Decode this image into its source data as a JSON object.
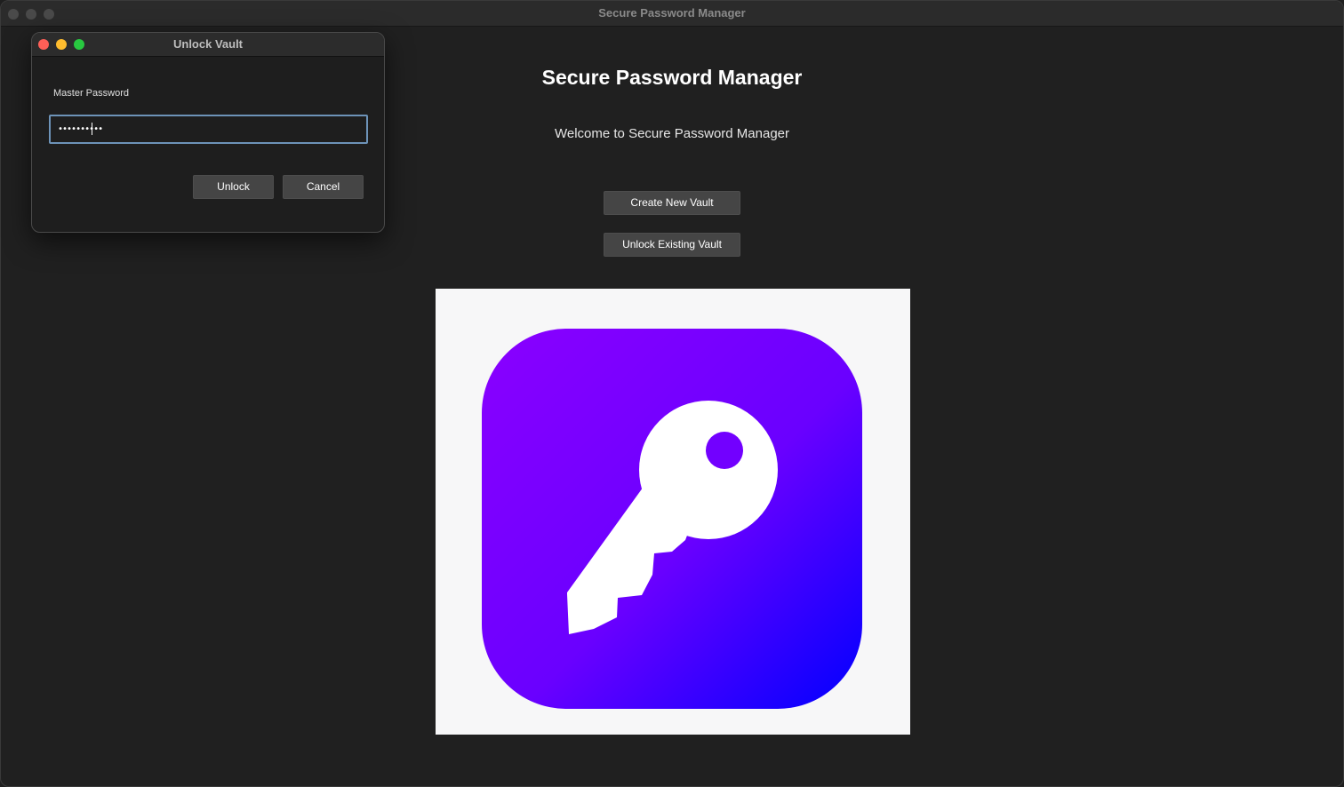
{
  "window": {
    "title": "Secure Password Manager"
  },
  "main": {
    "heading": "Secure Password Manager",
    "welcome": "Welcome to Secure Password Manager",
    "create_button": "Create New Vault",
    "unlock_button": "Unlock Existing Vault",
    "logo_icon": "key-icon",
    "logo_gradient": [
      "#8a00ff",
      "#6a00ff",
      "#0000ff"
    ]
  },
  "dialog": {
    "title": "Unlock Vault",
    "field_label": "Master Password",
    "password_value": "••••••••••",
    "unlock_label": "Unlock",
    "cancel_label": "Cancel"
  },
  "colors": {
    "traffic_red": "#fe5f57",
    "traffic_yellow": "#febc2e",
    "traffic_green": "#28c840",
    "input_focus": "#6d93b8"
  }
}
